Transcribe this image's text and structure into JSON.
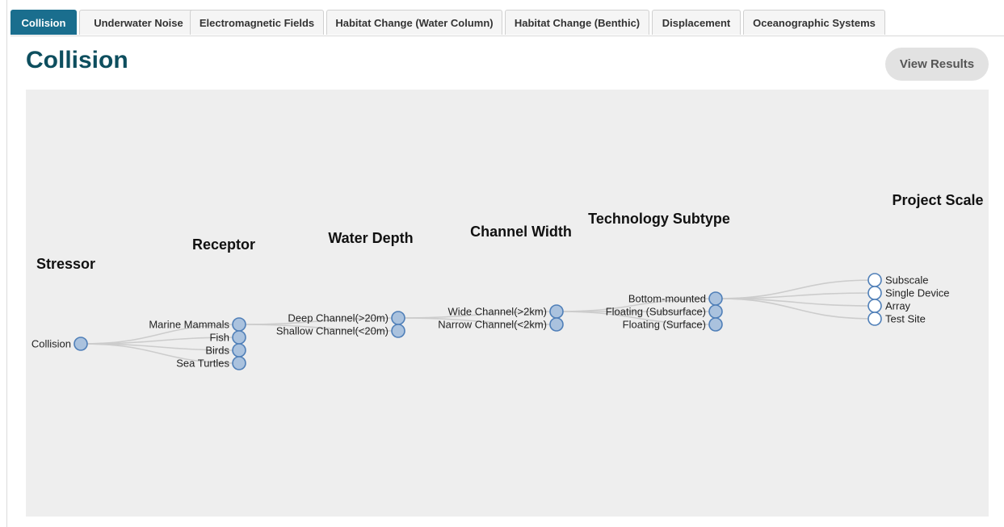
{
  "tabs": [
    {
      "label": "Collision",
      "active": true
    },
    {
      "label": "Underwater Noise",
      "active": false
    },
    {
      "label": "Electromagnetic Fields",
      "active": false
    },
    {
      "label": "Habitat Change (Water Column)",
      "active": false
    },
    {
      "label": "Habitat Change (Benthic)",
      "active": false
    },
    {
      "label": "Displacement",
      "active": false
    },
    {
      "label": "Oceanographic Systems",
      "active": false
    }
  ],
  "page_title": "Collision",
  "view_results_label": "View Results",
  "tree": {
    "levels": [
      {
        "title": "Stressor",
        "nodes": [
          {
            "label": "Collision"
          }
        ]
      },
      {
        "title": "Receptor",
        "nodes": [
          {
            "label": "Marine Mammals"
          },
          {
            "label": "Fish"
          },
          {
            "label": "Birds"
          },
          {
            "label": "Sea Turtles"
          }
        ]
      },
      {
        "title": "Water Depth",
        "nodes": [
          {
            "label": "Deep Channel(>20m)"
          },
          {
            "label": "Shallow Channel(<20m)"
          }
        ]
      },
      {
        "title": "Channel Width",
        "nodes": [
          {
            "label": "Wide Channel(>2km)"
          },
          {
            "label": "Narrow Channel(<2km)"
          }
        ]
      },
      {
        "title": "Technology Subtype",
        "nodes": [
          {
            "label": "Bottom-mounted"
          },
          {
            "label": "Floating (Subsurface)"
          },
          {
            "label": "Floating (Surface)"
          }
        ]
      },
      {
        "title": "Project Scale",
        "nodes": [
          {
            "label": "Subscale",
            "leaf": true
          },
          {
            "label": "Single Device",
            "leaf": true
          },
          {
            "label": "Array",
            "leaf": true
          },
          {
            "label": "Test Site",
            "leaf": true
          }
        ]
      }
    ]
  }
}
